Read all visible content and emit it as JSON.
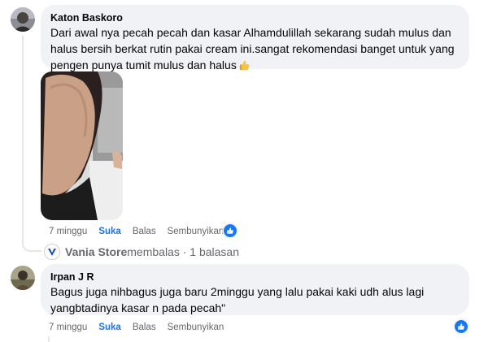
{
  "comments": [
    {
      "author": "Katon Baskoro",
      "text": "Dari awal nya pecah pecah dan kasar Alhamdulillah sekarang sudah mulus dan halus bersih berkat rutin pakai cream ini.sangat rekomendasi banget untuk yang pengen punya tumit mulus dan halus",
      "emoji": "thumbs-up",
      "time": "7 minggu",
      "like_label": "Suka",
      "reply_label": "Balas",
      "hide_label": "Sembunyikan",
      "reaction": "like"
    },
    {
      "author": "Irpan J R",
      "text": "Bagus juga nihbagus juga baru 2minggu yang lalu pakai kaki udh alus lagi yangbtadinya kasar n pada pecah\"",
      "time": "7 minggu",
      "like_label": "Suka",
      "reply_label": "Balas",
      "hide_label": "Sembunyikan",
      "reaction": "like"
    }
  ],
  "reply_summary": {
    "name": "Vania Store",
    "text": " membalas · 1 balasan",
    "logo": "vania-store-logo"
  },
  "colors": {
    "bubble": "#f0f2f5",
    "like_blue": "#1877f2",
    "meta_gray": "#65676b"
  }
}
